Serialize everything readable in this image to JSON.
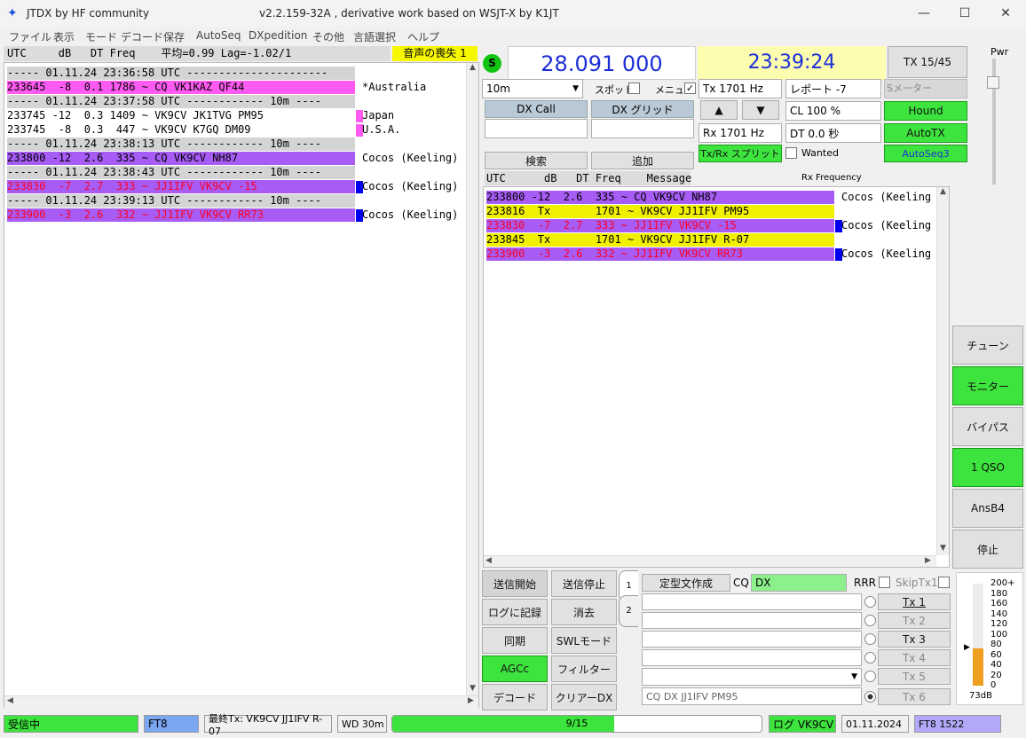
{
  "window": {
    "title": "JTDX  by HF community",
    "version": "v2.2.159-32A , derivative work based on WSJT-X by K1JT",
    "min": "—",
    "max": "☐",
    "close": "✕"
  },
  "menu": [
    "ファイル",
    "表示",
    "モード",
    "デコード",
    "保存",
    "AutoSeq",
    "DXpedition",
    "その他",
    "言語選択",
    "ヘルプ"
  ],
  "left": {
    "header": "UTC     dB   DT Freq    平均=0.99 Lag=-1.02/1",
    "audio_lost": "音声の喪失 1",
    "rows": [
      {
        "text": "----- 01.11.24 23:36:58 UTC ----------------------",
        "cls": "sep",
        "cc": ""
      },
      {
        "text": "233645  -8  0.1 1786 ~ CQ VK1KAZ QF44",
        "cls": "pink",
        "cc": "*Australia"
      },
      {
        "text": "----- 01.11.24 23:37:58 UTC ------------ 10m ----",
        "cls": "sep",
        "cc": ""
      },
      {
        "text": "233745 -12  0.3 1409 ~ VK9CV JK1TVG PM95",
        "cls": "",
        "cc": "Japan",
        "mark": "pink"
      },
      {
        "text": "233745  -8  0.3  447 ~ VK9CV K7GQ DM09",
        "cls": "",
        "cc": "U.S.A.",
        "mark": "pink"
      },
      {
        "text": "----- 01.11.24 23:38:13 UTC ------------ 10m ----",
        "cls": "sep",
        "cc": ""
      },
      {
        "text": "233800 -12  2.6  335 ~ CQ VK9CV NH87",
        "cls": "purp",
        "cc": "Cocos (Keeling)"
      },
      {
        "text": "----- 01.11.24 23:38:43 UTC ------------ 10m ----",
        "cls": "sep",
        "cc": ""
      },
      {
        "text": "233830  -7  2.7  333 ~ JJ1IFV VK9CV -15",
        "cls": "purp red",
        "cc": "Cocos (Keeling)",
        "mark": "blue"
      },
      {
        "text": "----- 01.11.24 23:39:13 UTC ------------ 10m ----",
        "cls": "sep",
        "cc": ""
      },
      {
        "text": "233900  -3  2.6  332 ~ JJ1IFV VK9CV RR73",
        "cls": "purp red",
        "cc": "Cocos (Keeling)",
        "mark": "blue"
      }
    ]
  },
  "top": {
    "s_label": "S",
    "freq": "28.091 000",
    "time": "23:39:24",
    "tx_btn": "TX 15/45",
    "pwr": "Pwr"
  },
  "controls": {
    "band": "10m",
    "spot": "スポット",
    "menu": "メニュー",
    "tx_hz": "Tx  1701  Hz",
    "report": "レポート -7",
    "smeter": "Sメーター",
    "dxcall": "DX Call",
    "dxgrid": "DX グリッド",
    "up": "▲",
    "down": "▼",
    "cl": "CL  100 %",
    "hound": "Hound",
    "rx_hz": "Rx  1701  Hz",
    "dt": "DT 0.0 秒",
    "autotx": "AutoTX",
    "search": "検索",
    "add": "追加",
    "split": "Tx/Rx スプリット",
    "wanted": "Wanted",
    "autoseq": "AutoSeq3",
    "rxfreq": "Rx Frequency"
  },
  "right": {
    "header": "UTC      dB   DT Freq    Message",
    "rows": [
      {
        "text": "233800 -12  2.6  335 ~ CQ VK9CV NH87",
        "cls": "purp",
        "cc": "Cocos (Keeling"
      },
      {
        "text": "233816  Tx       1701 ~ VK9CV JJ1IFV PM95",
        "cls": "yel",
        "cc": ""
      },
      {
        "text": "233830  -7  2.7  333 ~ JJ1IFV VK9CV -15",
        "cls": "purp red",
        "cc": "Cocos (Keeling",
        "mark": "blue"
      },
      {
        "text": "233845  Tx       1701 ~ VK9CV JJ1IFV R-07",
        "cls": "yel",
        "cc": ""
      },
      {
        "text": "233900  -3  2.6  332 ~ JJ1IFV VK9CV RR73",
        "cls": "purp red",
        "cc": "Cocos (Keeling",
        "mark": "blue"
      }
    ]
  },
  "side": [
    "チューン",
    "モニター",
    "バイパス",
    "1 QSO",
    "AnsB4",
    "停止"
  ],
  "bottom": {
    "start_tx": "送信開始",
    "stop_tx": "送信停止",
    "log": "ログに記録",
    "erase": "消去",
    "sync": "同期",
    "swl": "SWLモード",
    "agcc": "AGCc",
    "filter": "フィルター",
    "decode": "デコード",
    "clear_dx": "クリアーDX",
    "tab1": "1",
    "tab2": "2",
    "template": "定型文作成",
    "cq": "CQ",
    "cq_val": "DX",
    "rrr": "RRR",
    "skiptx1": "SkipTx1",
    "tx": [
      "Tx 1",
      "Tx 2",
      "Tx 3",
      "Tx 4",
      "Tx 5",
      "Tx 6"
    ],
    "tx6_msg": "CQ DX JJ1IFV PM95"
  },
  "meter": {
    "ticks": [
      "200+",
      "180",
      "160",
      "140",
      "120",
      "100",
      "80",
      "60",
      "40",
      "20",
      "0"
    ],
    "db": "73dB",
    "level": 0.365
  },
  "status": {
    "state": "受信中",
    "mode": "FT8",
    "last_tx": "最終Tx: VK9CV JJ1IFV R-07",
    "wd": "WD 30m",
    "progress": "9/15",
    "progress_frac": 0.6,
    "log": "ログ  VK9CV",
    "date": "01.11.2024",
    "modefreq": "FT8   1522"
  },
  "colors": {
    "pink": "#ff5bf2",
    "purple": "#a75cf5",
    "yellow": "#f0f000",
    "green": "#3ee43e",
    "red": "#ff0022"
  }
}
